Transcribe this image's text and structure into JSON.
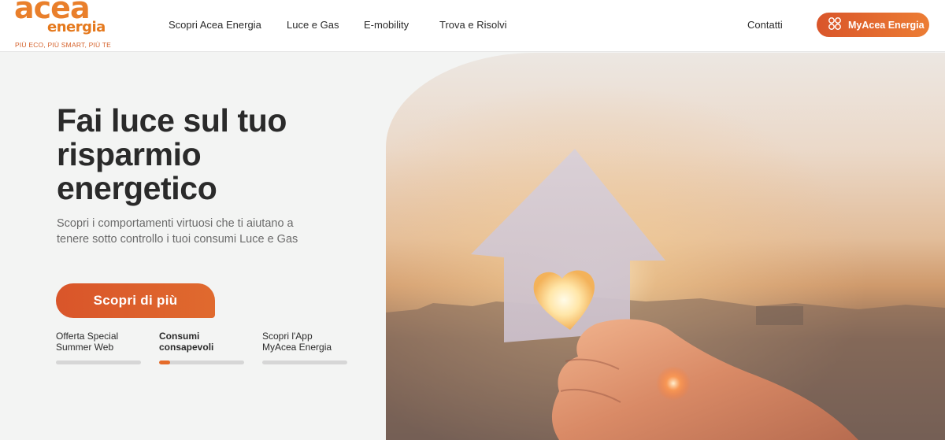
{
  "logo": {
    "word1": "acea",
    "word2": "energia",
    "tagline": "PIÙ ECO, PIÙ SMART, PIÙ TE"
  },
  "nav": {
    "items": [
      {
        "label": "Scopri Acea Energia"
      },
      {
        "label": "Luce e Gas"
      },
      {
        "label": "E-mobility"
      },
      {
        "label": "Trova e Risolvi"
      }
    ],
    "contatti": "Contatti",
    "myacea_label": "MyAcea Energia"
  },
  "hero": {
    "title": "Fai luce sul tuo risparmio energetico",
    "subtitle": "Scopri  i comportamenti virtuosi che ti aiutano a tenere sotto controllo i tuoi consumi Luce e Gas",
    "cta_label": "Scopri di più"
  },
  "slides": [
    {
      "label": "Offerta Special Summer Web",
      "progress": 0
    },
    {
      "label": "Consumi consapevoli",
      "progress": 0.13
    },
    {
      "label": "Scopri l'App MyAcea Energia",
      "progress": 0
    }
  ],
  "colors": {
    "accent": "#e06a2e",
    "logo_orange": "#e97f2b",
    "progress_track": "#d6d6d6"
  }
}
